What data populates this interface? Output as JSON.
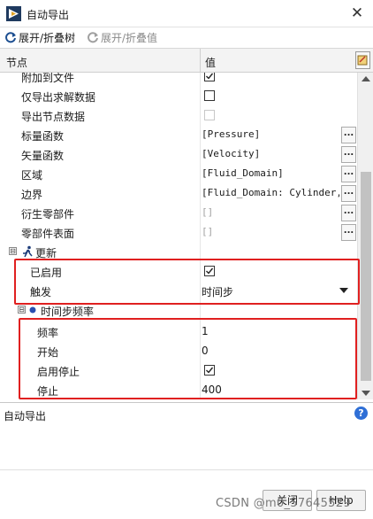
{
  "window": {
    "title": "自动导出",
    "close_glyph": "✕"
  },
  "toolbar": {
    "expand_tree_label": "展开/折叠树",
    "expand_values_label": "展开/折叠值"
  },
  "tree_header": {
    "node_col": "节点",
    "value_col": "值"
  },
  "rows": {
    "append_to_file": {
      "label": "附加到文件"
    },
    "export_solution_only": {
      "label": "仅导出求解数据"
    },
    "export_node_data": {
      "label": "导出节点数据"
    },
    "scalar_functions": {
      "label": "标量函数",
      "value": "[Pressure]"
    },
    "vector_functions": {
      "label": "矢量函数",
      "value": "[Velocity]"
    },
    "domains": {
      "label": "区域",
      "value": "[Fluid_Domain]"
    },
    "boundaries": {
      "label": "边界",
      "value": "[Fluid_Domain: Cylinder,…"
    },
    "derived_parts": {
      "label": "衍生零部件",
      "value": "[]"
    },
    "part_surfaces": {
      "label": "零部件表面",
      "value": "[]"
    },
    "update_group": {
      "label": "更新",
      "toggle": "⊟"
    },
    "enabled": {
      "label": "已启用"
    },
    "trigger": {
      "label": "触发",
      "value": "时间步"
    },
    "timestep_freq_group": {
      "label": "时间步频率",
      "toggle": "⊟"
    },
    "frequency": {
      "label": "频率",
      "value": "1"
    },
    "start": {
      "label": "开始",
      "value": "0"
    },
    "enable_stop": {
      "label": "启用停止"
    },
    "stop": {
      "label": "停止",
      "value": "400"
    }
  },
  "dots_label": "...",
  "description": {
    "text": "自动导出",
    "help_glyph": "?"
  },
  "footer": {
    "close_label": "关闭",
    "help_label": "Help",
    "watermark": "CSDN @m0_57645529"
  },
  "colors": {
    "highlight": "#e02020",
    "help_blue": "#2f6fd6"
  }
}
